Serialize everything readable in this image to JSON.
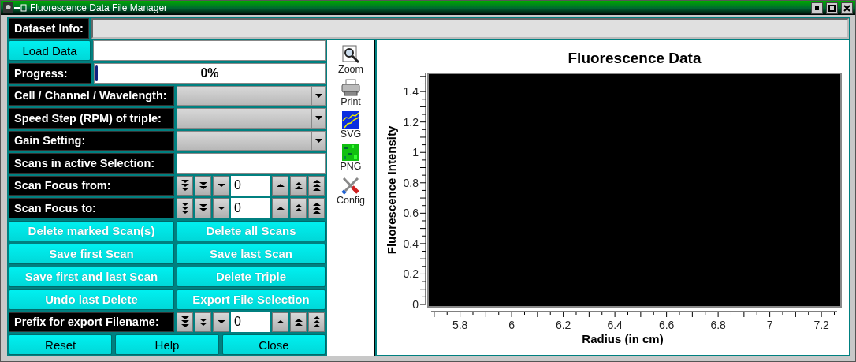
{
  "window": {
    "title": "Fluorescence Data File Manager"
  },
  "dataset_info": {
    "label": "Dataset Info:"
  },
  "load": {
    "button": "Load Data"
  },
  "progress": {
    "label": "Progress:",
    "level": 0,
    "reading": "0%"
  },
  "selectors": [
    {
      "label": "Cell / Channel / Wavelength:"
    },
    {
      "label": "Speed Step (RPM) of triple:"
    },
    {
      "label": "Gain Setting:"
    }
  ],
  "scans_field": {
    "label": "Scans in active Selection:"
  },
  "counters": [
    {
      "label": "Scan Focus from:",
      "value": "0"
    },
    {
      "label": "Scan Focus to:",
      "value": "0"
    }
  ],
  "action_buttons": [
    "Delete marked Scan(s)",
    "Delete all Scans",
    "Save first Scan",
    "Save last Scan",
    "Save first and last Scan",
    "Delete Triple",
    "Undo last Delete",
    "Export File Selection"
  ],
  "prefix": {
    "label": "Prefix for export Filename:",
    "value": "0"
  },
  "bottom_buttons": [
    "Reset",
    "Help",
    "Close"
  ],
  "toolbar": [
    {
      "label": "Zoom",
      "kind": "zoom"
    },
    {
      "label": "Print",
      "kind": "print"
    },
    {
      "label": "SVG",
      "kind": "svg"
    },
    {
      "label": "PNG",
      "kind": "png"
    },
    {
      "label": "Config",
      "kind": "config"
    }
  ],
  "plot": {
    "chart_data": {
      "type": "line",
      "title": "Fluorescence Data",
      "xlabel": "Radius (in cm)",
      "ylabel": "Fluorescence Intensity",
      "xlim": [
        5.676,
        7.276
      ],
      "ylim": [
        0,
        1.52
      ],
      "xticks": [
        5.8,
        6,
        6.2,
        6.4,
        6.6,
        6.8,
        7,
        7.2
      ],
      "yticks": [
        0,
        0.2,
        0.4,
        0.6,
        0.8,
        1,
        1.2,
        1.4
      ]
    }
  }
}
